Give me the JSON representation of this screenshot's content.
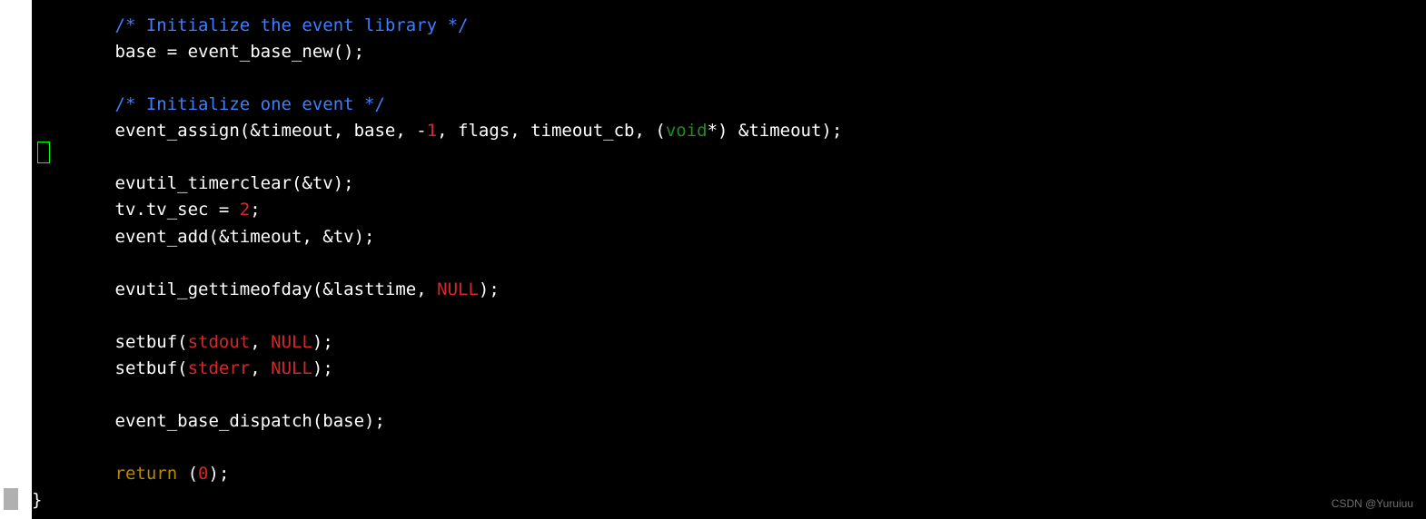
{
  "indent": "        ",
  "code": {
    "comment1": "/* Initialize the event library */",
    "line_base": "base = event_base_new();",
    "comment2": "/* Initialize one event */",
    "assign": {
      "pre": "event_assign(&timeout, base, -",
      "neg1": "1",
      "mid": ", flags, timeout_cb, (",
      "void_kw": "void",
      "post": "*) &timeout);"
    },
    "timerclear": "evutil_timerclear(&tv);",
    "tvsec": {
      "pre": "tv.tv_sec = ",
      "val": "2",
      "post": ";"
    },
    "eventadd": "event_add(&timeout, &tv);",
    "gettime": {
      "pre": "evutil_gettimeofday(&lasttime, ",
      "null": "NULL",
      "post": ");"
    },
    "setbuf1": {
      "pre": "setbuf(",
      "stream": "stdout",
      "mid": ", ",
      "null": "NULL",
      "post": ");"
    },
    "setbuf2": {
      "pre": "setbuf(",
      "stream": "stderr",
      "mid": ", ",
      "null": "NULL",
      "post": ");"
    },
    "dispatch": "event_base_dispatch(base);",
    "ret": {
      "kw": "return",
      "sp": " (",
      "zero": "0",
      "post": ");"
    },
    "closebrace": "}"
  },
  "watermark": "CSDN @Yuruiuu"
}
